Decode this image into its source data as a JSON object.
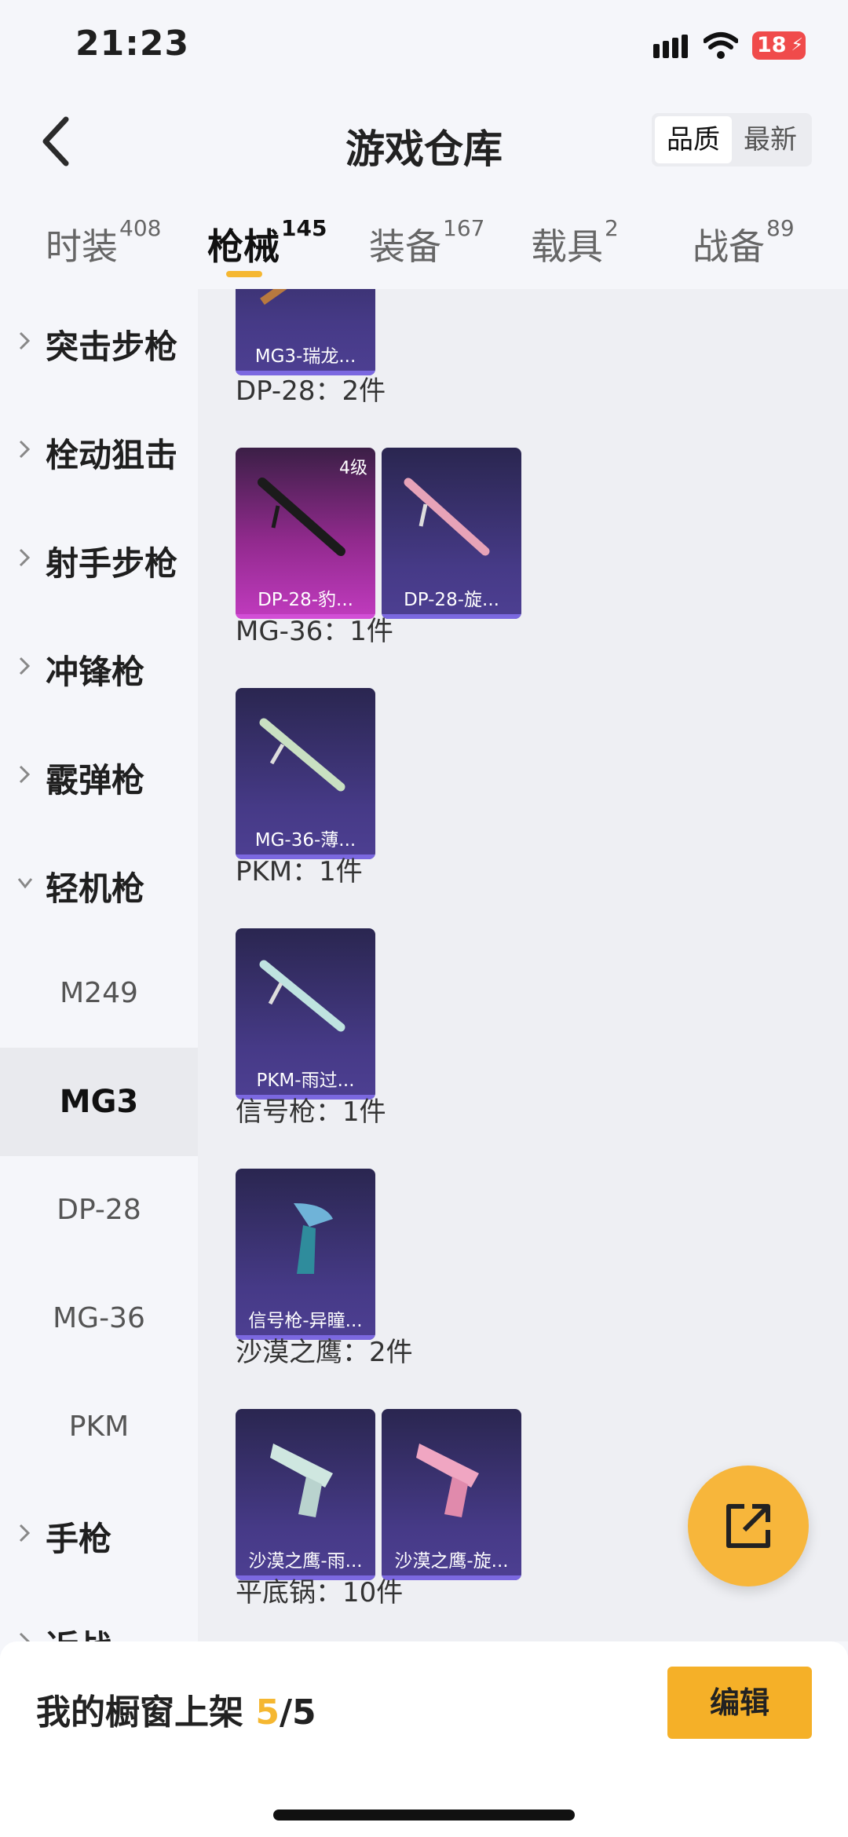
{
  "status": {
    "time": "21:23",
    "battery": "18"
  },
  "header": {
    "title": "游戏仓库",
    "sort": {
      "quality": "品质",
      "newest": "最新"
    }
  },
  "tabs": [
    {
      "label": "时装",
      "count": "408"
    },
    {
      "label": "枪械",
      "count": "145"
    },
    {
      "label": "装备",
      "count": "167"
    },
    {
      "label": "载具",
      "count": "2"
    },
    {
      "label": "战备",
      "count": "89"
    }
  ],
  "sidebar": {
    "categories": [
      "突击步枪",
      "栓动狙击",
      "射手步枪",
      "冲锋枪",
      "霰弹枪",
      "轻机枪"
    ],
    "subitems": [
      "M249",
      "MG3",
      "DP-28",
      "MG-36",
      "PKM"
    ],
    "after": [
      "手枪",
      "近战"
    ]
  },
  "content": {
    "sections": [
      {
        "title": "DP-28：2件",
        "cards": [
          "DP-28-豹...",
          "DP-28-旋..."
        ],
        "level": "4级"
      },
      {
        "title": "MG-36：1件",
        "cards": [
          "MG-36-薄..."
        ]
      },
      {
        "title": "PKM：1件",
        "cards": [
          "PKM-雨过..."
        ]
      },
      {
        "title": "信号枪：1件",
        "cards": [
          "信号枪-异瞳..."
        ]
      },
      {
        "title": "沙漠之鹰：2件",
        "cards": [
          "沙漠之鹰-雨...",
          "沙漠之鹰-旋..."
        ]
      },
      {
        "title": "平底锅：10件"
      }
    ],
    "top_card": "MG3-瑞龙..."
  },
  "bottom": {
    "shelf_label": "我的橱窗上架 ",
    "shelf_current": "5",
    "shelf_total": "/5",
    "edit": "编辑"
  },
  "colors": {
    "accent": "#f5b731",
    "card_blue": "#463a87",
    "card_purple": "#c13bbf"
  }
}
